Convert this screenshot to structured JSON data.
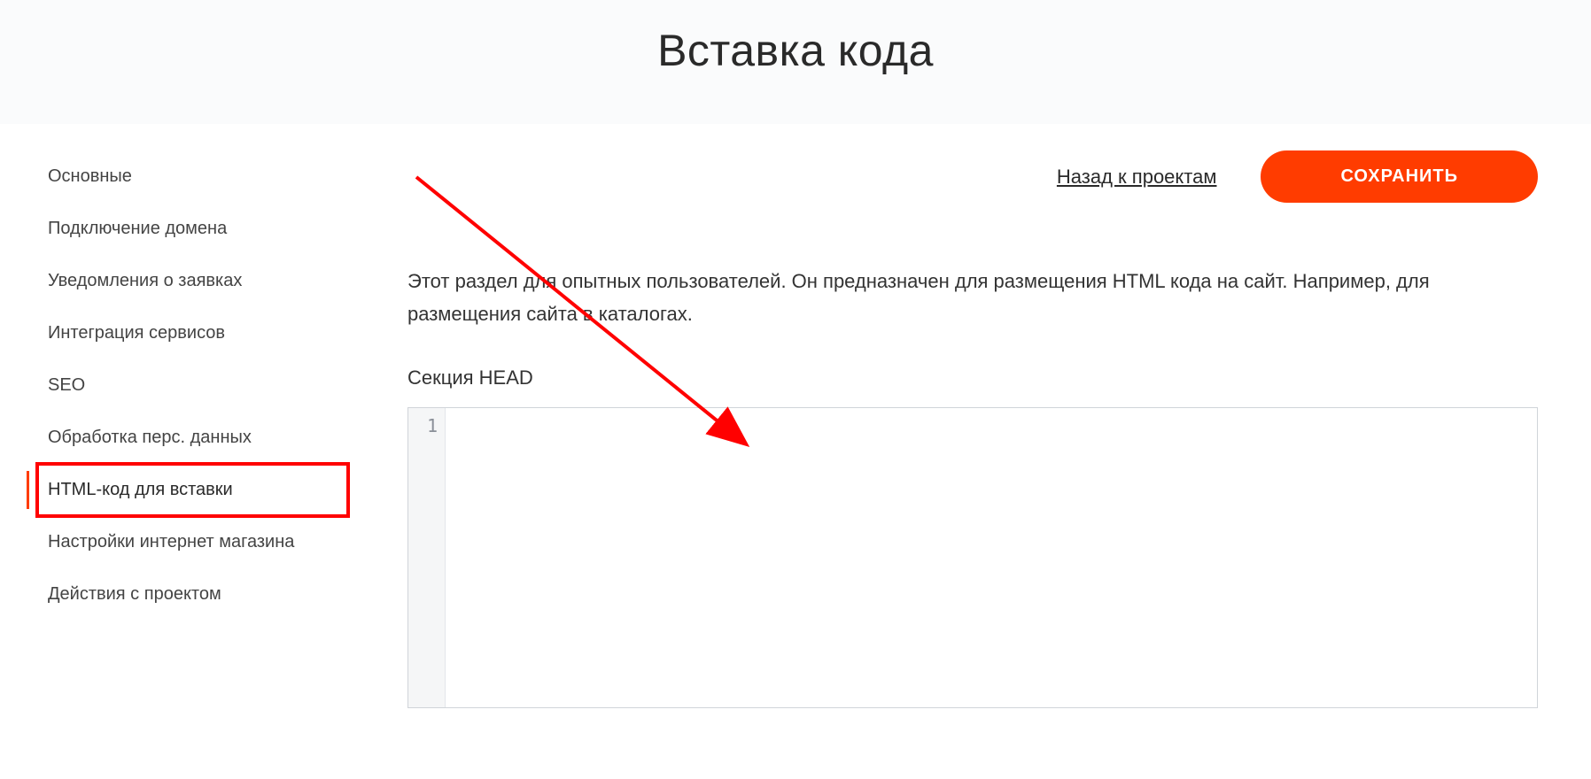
{
  "header": {
    "title": "Вставка кода"
  },
  "sidebar": {
    "items": [
      {
        "label": "Основные"
      },
      {
        "label": "Подключение домена"
      },
      {
        "label": "Уведомления о заявках"
      },
      {
        "label": "Интеграция сервисов"
      },
      {
        "label": "SEO"
      },
      {
        "label": "Обработка перс. данных"
      },
      {
        "label": "HTML-код для вставки"
      },
      {
        "label": "Настройки интернет магазина"
      },
      {
        "label": "Действия с проектом"
      }
    ],
    "active_index": 6
  },
  "actions": {
    "back_label": "Назад к проектам",
    "save_label": "СОХРАНИТЬ"
  },
  "main": {
    "description": "Этот раздел для опытных пользователей. Он предназначен для размещения HTML кода на сайт. Например, для размещения сайта в каталогах.",
    "section_label": "Секция HEAD",
    "editor": {
      "line_number": "1",
      "content": ""
    }
  },
  "annotation": {
    "arrow_color": "#ff0000"
  }
}
